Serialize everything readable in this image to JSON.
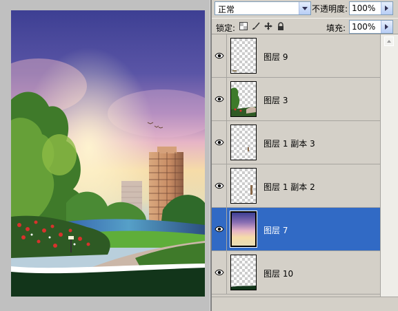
{
  "toolbar": {
    "blend_mode": "正常",
    "opacity_label": "不透明度:",
    "opacity_value": "100%",
    "lock_label": "锁定:",
    "fill_label": "填充:",
    "fill_value": "100%"
  },
  "layers": [
    {
      "name": "图层 9",
      "selected": false
    },
    {
      "name": "图层 3",
      "selected": false
    },
    {
      "name": "图层 1 副本 3",
      "selected": false
    },
    {
      "name": "图层 1 副本 2",
      "selected": false
    },
    {
      "name": "图层 7",
      "selected": true
    },
    {
      "name": "图层 10",
      "selected": false
    }
  ],
  "colors": {
    "selection": "#316ac5",
    "panel": "#d4d0c8",
    "workspace": "#c0c0c0"
  },
  "icons": [
    "eye-icon",
    "lock-transparent-icon",
    "lock-brush-icon",
    "lock-move-icon",
    "lock-all-icon",
    "dropdown-arrow-icon",
    "flyout-arrow-icon"
  ]
}
